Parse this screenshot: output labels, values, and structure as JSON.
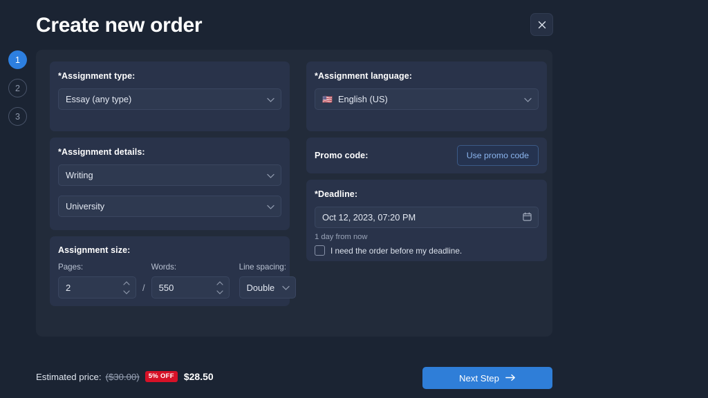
{
  "header": {
    "title": "Create new order",
    "close_icon": "close-icon"
  },
  "steps": [
    {
      "label": "1",
      "state": "active"
    },
    {
      "label": "2",
      "state": "idle"
    },
    {
      "label": "3",
      "state": "idle"
    }
  ],
  "left_column": {
    "assignment_type": {
      "label": "*Assignment type:",
      "value": "Essay (any type)"
    },
    "assignment_details": {
      "label": "*Assignment details:",
      "service_value": "Writing",
      "level_value": "University"
    },
    "assignment_size": {
      "label": "Assignment size:",
      "pages_label": "Pages:",
      "pages_value": "2",
      "separator": "/",
      "words_label": "Words:",
      "words_value": "550",
      "spacing_label": "Line spacing:",
      "spacing_value": "Double"
    }
  },
  "right_column": {
    "assignment_language": {
      "label": "*Assignment language:",
      "flag": "🇺🇸",
      "value": "English (US)"
    },
    "promo": {
      "label": "Promo code:",
      "button_label": "Use promo code"
    },
    "deadline": {
      "label": "*Deadline:",
      "value": "Oct 12, 2023, 07:20 PM",
      "calendar_icon": "calendar-icon",
      "hint": "1 day from now",
      "checkbox_label": "I need the order before my deadline.",
      "checkbox_checked": false
    }
  },
  "footer": {
    "price_label": "Estimated price:",
    "original_price": "($30.00)",
    "discount_badge": "5% OFF",
    "final_price": "$28.50",
    "next_button": "Next Step",
    "next_arrow": "→"
  },
  "colors": {
    "page_bg": "#1b2433",
    "card_bg": "#222b3a",
    "group_bg": "#29334a",
    "field_bg": "#2e3950",
    "accent": "#2f7ed8",
    "danger": "#d61127",
    "promo_text": "#8cb6ef"
  }
}
